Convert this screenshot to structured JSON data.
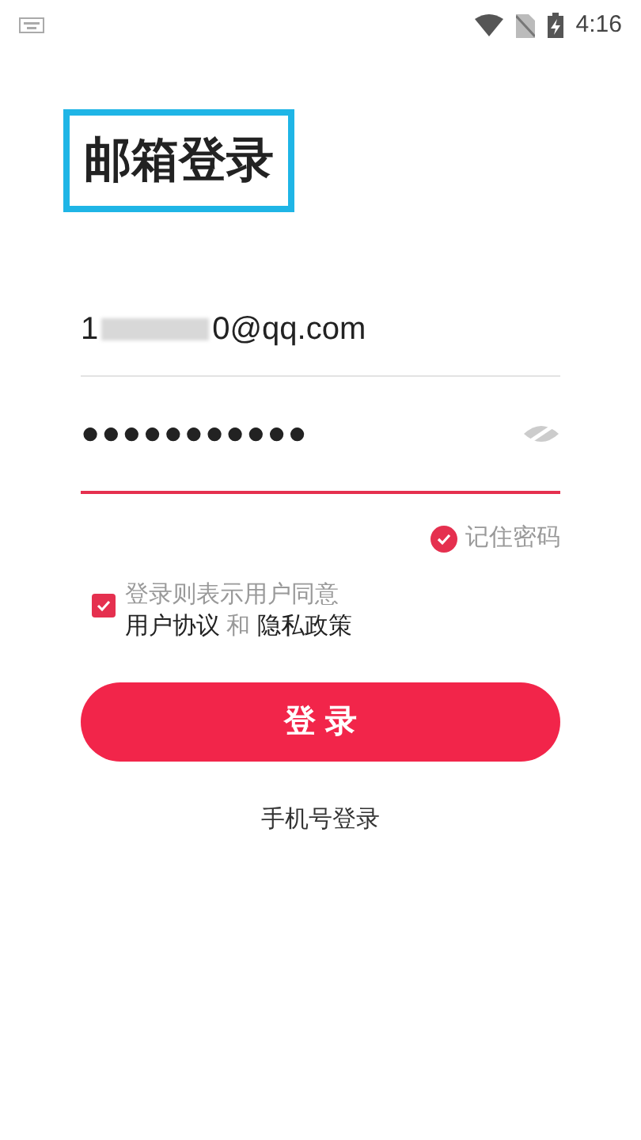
{
  "status_bar": {
    "time": "4:16"
  },
  "title": "邮箱登录",
  "email": {
    "value_start": "1",
    "value_end": "0@qq.com",
    "masked": true
  },
  "password": {
    "value": "●●●●●●●●●●●",
    "focused": true
  },
  "remember": {
    "label": "记住密码",
    "checked": true
  },
  "agreement": {
    "checked": true,
    "parts": [
      {
        "kind": "text",
        "text": "登录则表示用户同意"
      },
      {
        "kind": "link",
        "text": "用户协议"
      },
      {
        "kind": "text",
        "text": "和"
      },
      {
        "kind": "link",
        "text": "隐私政策"
      }
    ]
  },
  "login_button": "登 录",
  "alt_login": "手机号登录"
}
